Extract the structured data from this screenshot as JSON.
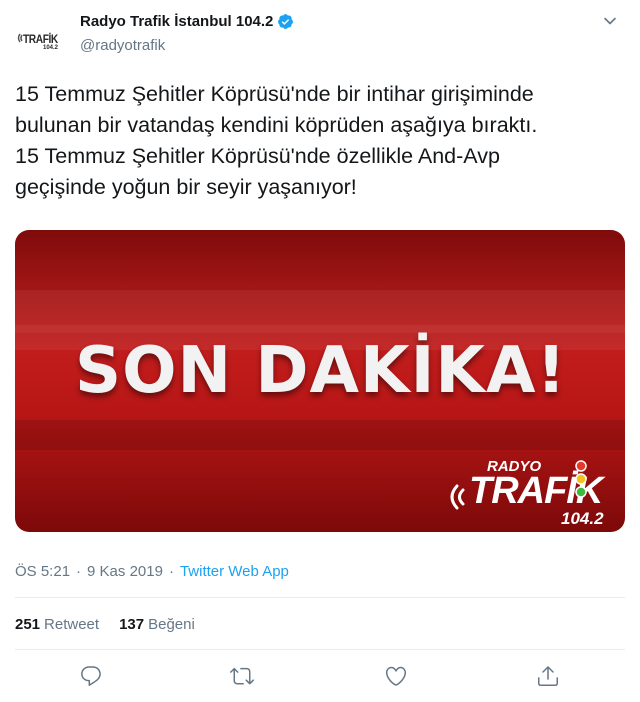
{
  "profile": {
    "avatar_text": "TRAFİK",
    "avatar_sub": "104.2",
    "display_name": "Radyo Trafik İstanbul 104.2",
    "handle": "@radyotrafik",
    "verified": true,
    "verified_color": "#1da1f2"
  },
  "tweet": {
    "lines": [
      "15 Temmuz Şehitler Köprüsü'nde bir intihar girişiminde",
      "bulunan bir vatandaş kendini köprüden aşağıya bıraktı.",
      "15 Temmuz Şehitler Köprüsü'nde özellikle And-Avp",
      "geçişinde yoğun bir seyir yaşanıyor!"
    ]
  },
  "media": {
    "headline": "SON DAKİKA!",
    "logo_top": "RADYO",
    "logo_main": "TRAFİK",
    "logo_freq": "104.2",
    "background_color": "#b81616"
  },
  "meta": {
    "time": "ÖS 5:21",
    "separator": "·",
    "date": "9 Kas 2019",
    "source": "Twitter Web App",
    "source_color": "#1da1f2"
  },
  "stats": {
    "retweets_count": "251",
    "retweets_label": "Retweet",
    "likes_count": "137",
    "likes_label": "Beğeni"
  },
  "actions": {
    "icons": [
      "reply-icon",
      "retweet-icon",
      "like-icon",
      "share-icon"
    ],
    "icon_color": "#657786"
  }
}
